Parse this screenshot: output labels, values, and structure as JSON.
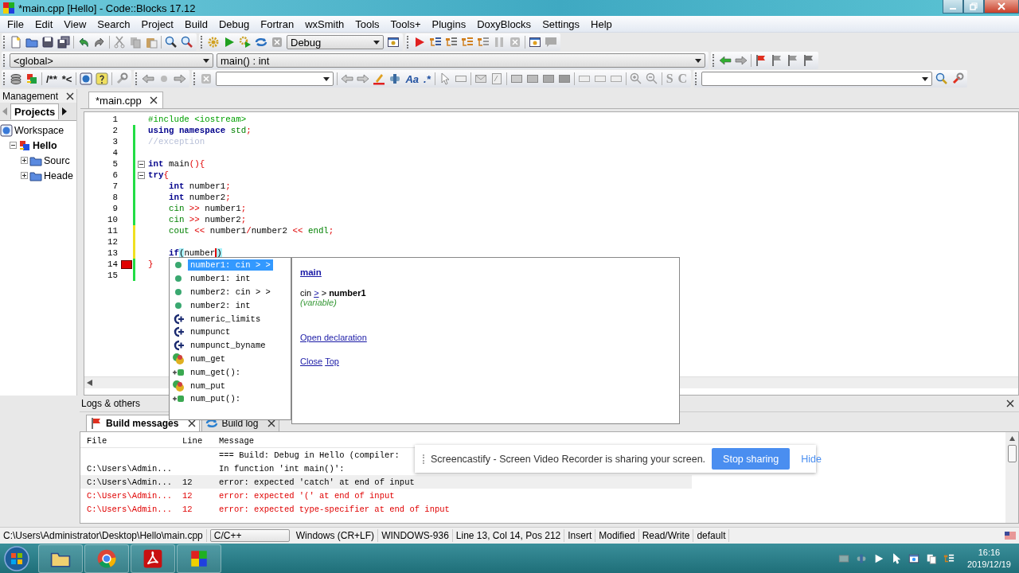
{
  "window": {
    "title": "*main.cpp [Hello] - Code::Blocks 17.12"
  },
  "menu": [
    "File",
    "Edit",
    "View",
    "Search",
    "Project",
    "Build",
    "Debug",
    "Fortran",
    "wxSmith",
    "Tools",
    "Tools+",
    "Plugins",
    "DoxyBlocks",
    "Settings",
    "Help"
  ],
  "toolbar": {
    "build_target": "Debug",
    "scope": "<global>",
    "symbol": "main() : int",
    "comment_buttons": [
      "/**",
      "*<"
    ],
    "search_options": [
      "Aa",
      ".*"
    ],
    "symbol_buttons": [
      "S",
      "C"
    ]
  },
  "management": {
    "title": "Management",
    "tabs": [
      {
        "label": "Projects",
        "selected": true
      }
    ],
    "tree": [
      {
        "label": "Workspace",
        "kind": "workspace",
        "active": false,
        "children": [
          {
            "label": "Hello",
            "kind": "project",
            "active": true,
            "expanded": true,
            "children": [
              {
                "label": "Sourc",
                "kind": "folder",
                "active": false,
                "expanded": false
              },
              {
                "label": "Heade",
                "kind": "folder",
                "active": false,
                "expanded": false
              }
            ]
          }
        ]
      }
    ]
  },
  "editor": {
    "tabs": [
      {
        "label": "*main.cpp",
        "selected": true
      }
    ],
    "lines": [
      {
        "number": "1",
        "kind": "plain",
        "fold": false,
        "error": false,
        "code": [
          {
            "kind": "preprocessor",
            "text": "#include <iostream>"
          }
        ]
      },
      {
        "number": "2",
        "kind": "saved",
        "fold": false,
        "error": false,
        "code": [
          {
            "kind": "keyword",
            "text": "using namespace"
          },
          {
            "kind": "library",
            "text": " std"
          },
          {
            "kind": "operator",
            "text": ";"
          }
        ]
      },
      {
        "number": "3",
        "kind": "saved",
        "fold": false,
        "error": false,
        "code": [
          {
            "kind": "comment",
            "text": "//exception"
          }
        ]
      },
      {
        "number": "4",
        "kind": "saved",
        "fold": false,
        "error": false
      },
      {
        "number": "5",
        "kind": "saved",
        "fold": true,
        "error": false,
        "code": [
          {
            "kind": "keyword",
            "text": "int"
          },
          {
            "kind": "identifier",
            "text": " main"
          },
          {
            "kind": "operator",
            "text": "(){"
          }
        ]
      },
      {
        "number": "6",
        "kind": "saved",
        "fold": true,
        "error": false,
        "code": [
          {
            "kind": "keyword",
            "text": "try"
          },
          {
            "kind": "operator",
            "text": "{"
          }
        ]
      },
      {
        "number": "7",
        "kind": "saved",
        "fold": false,
        "error": false,
        "code": [
          {
            "kind": "keyword",
            "text": "    int"
          },
          {
            "kind": "identifier",
            "text": " number1"
          },
          {
            "kind": "operator",
            "text": ";"
          }
        ]
      },
      {
        "number": "8",
        "kind": "saved",
        "fold": false,
        "error": false,
        "code": [
          {
            "kind": "keyword",
            "text": "    int"
          },
          {
            "kind": "identifier",
            "text": " number2"
          },
          {
            "kind": "operator",
            "text": ";"
          }
        ]
      },
      {
        "number": "9",
        "kind": "saved",
        "fold": false,
        "error": false,
        "code": [
          {
            "kind": "library",
            "text": "    cin"
          },
          {
            "kind": "operator",
            "text": " >>"
          },
          {
            "kind": "identifier",
            "text": " number1"
          },
          {
            "kind": "operator",
            "text": ";"
          }
        ]
      },
      {
        "number": "10",
        "kind": "saved",
        "fold": false,
        "error": false,
        "code": [
          {
            "kind": "library",
            "text": "    cin"
          },
          {
            "kind": "operator",
            "text": " >>"
          },
          {
            "kind": "identifier",
            "text": " number2"
          },
          {
            "kind": "operator",
            "text": ";"
          }
        ]
      },
      {
        "number": "11",
        "kind": "modified",
        "fold": false,
        "error": false,
        "code": [
          {
            "kind": "library",
            "text": "    cout"
          },
          {
            "kind": "operator",
            "text": " <<"
          },
          {
            "kind": "identifier",
            "text": " number1"
          },
          {
            "kind": "operator",
            "text": "/"
          },
          {
            "kind": "identifier",
            "text": "number2"
          },
          {
            "kind": "operator",
            "text": " <<"
          },
          {
            "kind": "library",
            "text": " endl"
          },
          {
            "kind": "operator",
            "text": ";"
          }
        ]
      },
      {
        "number": "12",
        "kind": "modified",
        "fold": false,
        "error": false
      },
      {
        "number": "13",
        "kind": "modified",
        "fold": false,
        "error": false,
        "code": [
          {
            "kind": "keyword",
            "text": "    if"
          },
          {
            "kind": "brace",
            "text": "("
          },
          {
            "kind": "identifier",
            "text": "number"
          },
          {
            "kind": "brace_at_cursor",
            "text": ")"
          }
        ]
      },
      {
        "number": "14",
        "kind": "saved",
        "fold": false,
        "error": true,
        "code": [
          {
            "kind": "operator",
            "text": "}"
          }
        ]
      },
      {
        "number": "15",
        "kind": "saved",
        "fold": false,
        "error": false
      }
    ],
    "autocomplete": {
      "items": [
        {
          "label": "number1: cin > >",
          "kind": "variable",
          "selected": true
        },
        {
          "label": "number1: int",
          "kind": "variable",
          "selected": false
        },
        {
          "label": "number2: cin > >",
          "kind": "variable",
          "selected": false
        },
        {
          "label": "number2: int",
          "kind": "variable",
          "selected": false
        },
        {
          "label": "numeric_limits",
          "kind": "class",
          "selected": false
        },
        {
          "label": "numpunct",
          "kind": "class",
          "selected": false
        },
        {
          "label": "numpunct_byname",
          "kind": "class",
          "selected": false
        },
        {
          "label": "num_get",
          "kind": "type",
          "selected": false
        },
        {
          "label": "num_get():",
          "kind": "function",
          "selected": false
        },
        {
          "label": "num_put",
          "kind": "type",
          "selected": false
        },
        {
          "label": "num_put():",
          "kind": "function",
          "selected": false
        }
      ],
      "doc": {
        "title": "main",
        "signature": [
          {
            "kind": "text",
            "text": "cin"
          },
          {
            "kind": "link",
            "text": ">"
          },
          {
            "kind": "text",
            "text": ">"
          },
          {
            "kind": "bold",
            "text": "number1"
          }
        ],
        "category": "(variable)",
        "links": [
          "Open declaration"
        ],
        "footer_links": [
          "Close",
          "Top"
        ]
      }
    }
  },
  "logs": {
    "title": "Logs & others",
    "tabs": [
      {
        "label": "Build messages",
        "kind": "build",
        "selected": true
      },
      {
        "label": "Build log",
        "kind": "log",
        "selected": false
      }
    ],
    "columns": [
      "File",
      "Line",
      "Message"
    ],
    "rows": [
      {
        "message": "=== Build: Debug in Hello (compiler:",
        "kind": "info",
        "selected": false
      },
      {
        "file": "C:\\Users\\Admin...",
        "message": "In function 'int main()':",
        "kind": "info",
        "selected": false
      },
      {
        "file": "C:\\Users\\Admin...",
        "line": "12",
        "message": "error: expected 'catch' at end of input",
        "kind": "error",
        "selected": true
      },
      {
        "file": "C:\\Users\\Admin...",
        "line": "12",
        "message": "error: expected '(' at end of input",
        "kind": "error",
        "selected": false
      },
      {
        "file": "C:\\Users\\Admin...",
        "line": "12",
        "message": "error: expected type-specifier at end of input",
        "kind": "error",
        "selected": false
      }
    ]
  },
  "share_bar": {
    "message": "Screencastify - Screen Video Recorder is sharing your screen.",
    "stop": "Stop sharing",
    "hide": "Hide"
  },
  "status_bar": [
    {
      "text": "C:\\Users\\Administrator\\Desktop\\Hello\\main.cpp",
      "kind": "plain"
    },
    {
      "text": "C/C++",
      "kind": "boxed"
    },
    {
      "text": "Windows (CR+LF)",
      "kind": "plain"
    },
    {
      "text": "WINDOWS-936",
      "kind": "plain"
    },
    {
      "text": "Line 13, Col 14, Pos 212",
      "kind": "plain"
    },
    {
      "text": "Insert",
      "kind": "plain"
    },
    {
      "text": "Modified",
      "kind": "plain"
    },
    {
      "text": "Read/Write",
      "kind": "plain"
    },
    {
      "text": "default",
      "kind": "plain"
    }
  ],
  "taskbar": {
    "apps": [
      {
        "kind": "explorer"
      },
      {
        "kind": "browser"
      },
      {
        "kind": "pdf"
      },
      {
        "kind": "ide"
      }
    ],
    "time": "16:16",
    "date": "2019/12/19"
  }
}
